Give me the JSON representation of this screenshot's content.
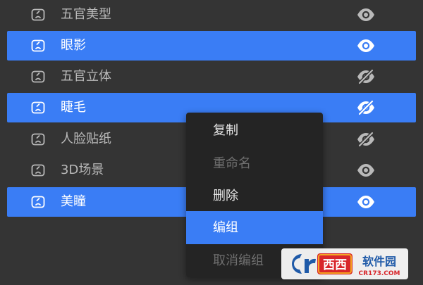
{
  "colors": {
    "panel_background": "#343434",
    "selection_blue": "#3a7df5",
    "menu_background": "#242424",
    "disabled_text": "#6f6f6f",
    "watermark_red": "#d8262b",
    "watermark_orange": "#f5a623",
    "watermark_blue": "#1f5aa8"
  },
  "layers": [
    {
      "label": "五官美型",
      "selected": false,
      "visible": true,
      "icon": "face-layer-icon",
      "eye_icon": "eye-icon"
    },
    {
      "label": "眼影",
      "selected": true,
      "visible": true,
      "icon": "face-layer-icon",
      "eye_icon": "eye-icon"
    },
    {
      "label": "五官立体",
      "selected": false,
      "visible": false,
      "icon": "face-layer-icon",
      "eye_icon": "eye-hidden-icon"
    },
    {
      "label": "睫毛",
      "selected": true,
      "visible": false,
      "icon": "face-layer-icon",
      "eye_icon": "eye-hidden-icon"
    },
    {
      "label": "人脸贴纸",
      "selected": false,
      "visible": false,
      "icon": "face-layer-icon",
      "eye_icon": "eye-hidden-icon"
    },
    {
      "label": "3D场景",
      "selected": false,
      "visible": true,
      "icon": "face-layer-icon",
      "eye_icon": "eye-icon"
    },
    {
      "label": "美瞳",
      "selected": true,
      "visible": true,
      "icon": "face-layer-icon",
      "eye_icon": "eye-icon"
    }
  ],
  "context_menu": {
    "items": [
      {
        "label": "复制",
        "enabled": true,
        "highlighted": false
      },
      {
        "label": "重命名",
        "enabled": false,
        "highlighted": false
      },
      {
        "label": "删除",
        "enabled": true,
        "highlighted": false
      },
      {
        "label": "编组",
        "enabled": true,
        "highlighted": true
      },
      {
        "label": "取消编组",
        "enabled": false,
        "highlighted": false
      }
    ]
  },
  "watermark": {
    "logo": "cr173-logo",
    "text_main": "西西软件园",
    "text_url": "CR173.COM"
  }
}
